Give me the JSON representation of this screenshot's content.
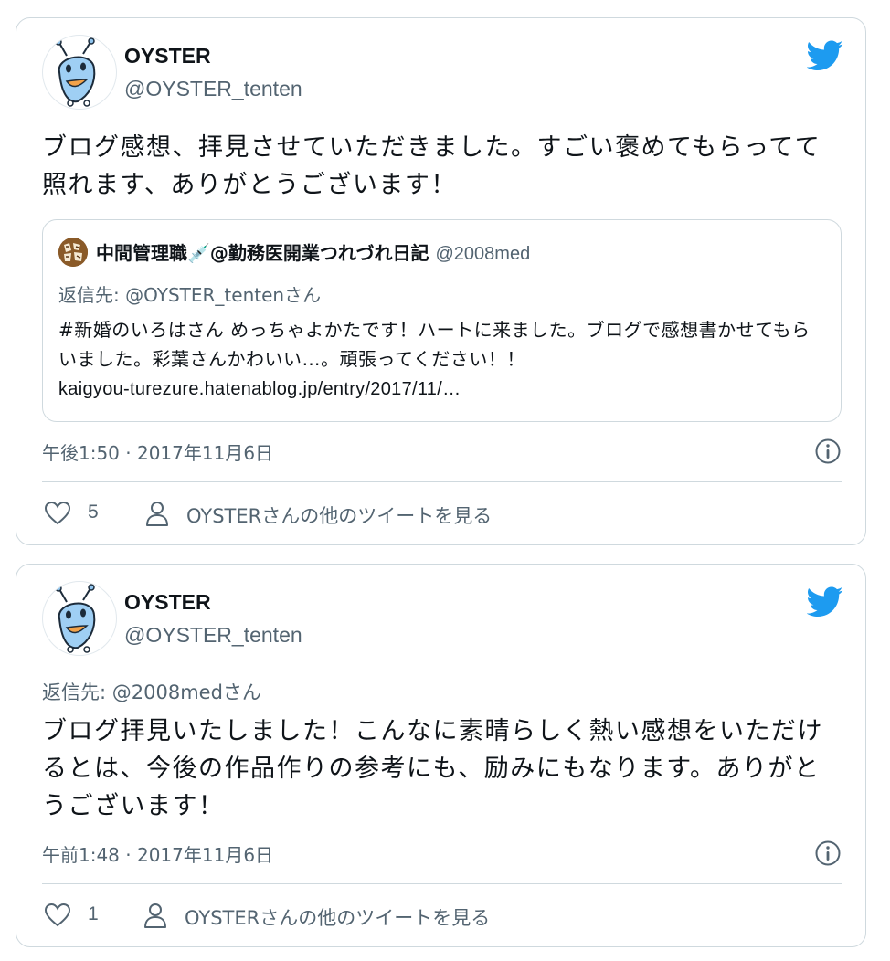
{
  "tweets": [
    {
      "author": {
        "name": "OYSTER",
        "handle": "@OYSTER_tenten",
        "avatar": "alien-mascot-avatar"
      },
      "text": "ブログ感想、拝見させていただきました。すごい褒めてもらってて照れます、ありがとうございます！",
      "quote": {
        "author_name": "中間管理職💉@勤務医開業つれづれ日記",
        "author_handle": "@2008med",
        "reply_prefix": "返信先: ",
        "reply_to": "@OYSTER_tenten",
        "reply_suffix": "さん",
        "text": "#新婚のいろはさん めっちゃよかたです！ハートに来ました。ブログで感想書かせてもらいました。彩葉さんかわいい…。頑張ってください！！",
        "link": "kaigyou-turezure.hatenablog.jp/entry/2017/11/…"
      },
      "timestamp": "午後1:50 · 2017年11月6日",
      "likes": "5",
      "more_tweets": "OYSTERさんの他のツイートを見る"
    },
    {
      "author": {
        "name": "OYSTER",
        "handle": "@OYSTER_tenten",
        "avatar": "alien-mascot-avatar"
      },
      "reply_prefix": "返信先: ",
      "reply_to": "@2008med",
      "reply_suffix": "さん",
      "text": "ブログ拝見いたしました！こんなに素晴らしく熱い感想をいただけるとは、今後の作品作りの参考にも、励みにもなります。ありがとうございます！",
      "timestamp": "午前1:48 · 2017年11月6日",
      "likes": "1",
      "more_tweets": "OYSTERさんの他のツイートを見る"
    }
  ],
  "colors": {
    "twitter_blue": "#1d9bf0",
    "secondary_text": "#536471",
    "border": "#cfd9de"
  },
  "icons": [
    "twitter-bird-icon",
    "info-icon",
    "heart-icon",
    "person-icon"
  ]
}
